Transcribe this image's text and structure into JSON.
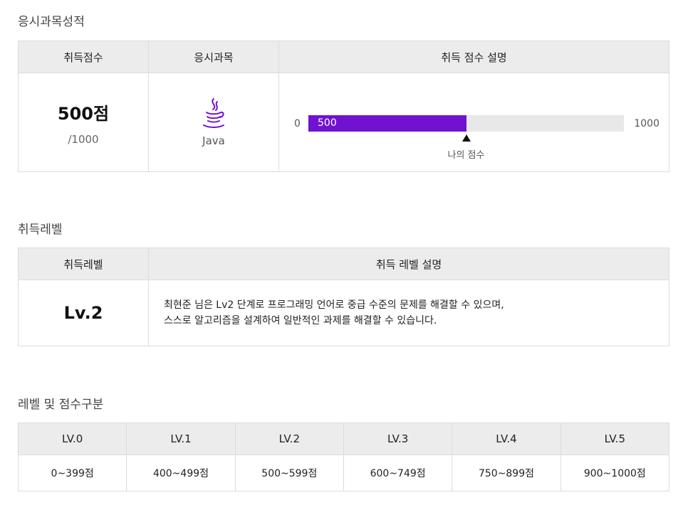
{
  "section1": {
    "title": "응시과목성적",
    "headers": [
      "취득점수",
      "응시과목",
      "취득 점수 설명"
    ],
    "score": "500점",
    "score_total": "/1000",
    "subject_icon": "java-icon",
    "subject_name": "Java",
    "bar": {
      "min_label": "0",
      "max_label": "1000",
      "value_label": "500",
      "value": 500,
      "max": 1000,
      "fill_color": "#7012d0",
      "marker_label": "나의 점수"
    }
  },
  "section2": {
    "title": "취득레벨",
    "headers": [
      "취득레벨",
      "취득 레벨 설명"
    ],
    "level": "Lv.2",
    "description_line1": "최현준 님은 Lv2 단계로 프로그래밍 언어로 중급 수준의 문제를 해결할 수 있으며,",
    "description_line2": "스스로 알고리즘을 설계하여 일반적인 과제를 해결할 수 있습니다."
  },
  "section3": {
    "title": "레벨 및 점수구분",
    "levels": [
      "LV.0",
      "LV.1",
      "LV.2",
      "LV.3",
      "LV.4",
      "LV.5"
    ],
    "ranges": [
      "0~399점",
      "400~499점",
      "500~599점",
      "600~749점",
      "750~899점",
      "900~1000점"
    ]
  }
}
